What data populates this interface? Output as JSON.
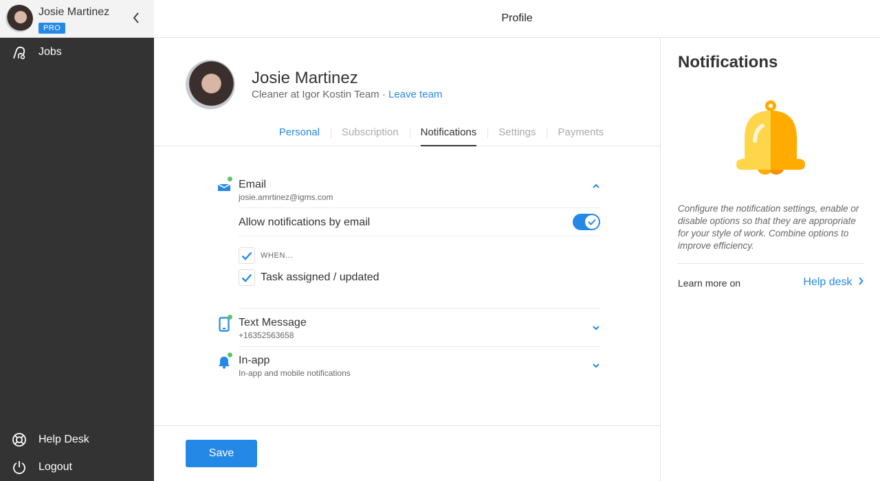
{
  "sidebar": {
    "user_name": "Josie Martinez",
    "badge": "PRO",
    "collapse_icon": "chevron-left",
    "items": [
      {
        "label": "Jobs",
        "icon": "vacuum-icon"
      }
    ],
    "bottom_items": [
      {
        "label": "Help Desk",
        "icon": "lifebuoy-icon"
      },
      {
        "label": "Logout",
        "icon": "power-icon"
      }
    ]
  },
  "header": {
    "title": "Profile"
  },
  "profile": {
    "name": "Josie Martinez",
    "role": "Cleaner at Igor Kostin Team",
    "separator": " · ",
    "leave_link": "Leave team"
  },
  "tabs": [
    {
      "label": "Personal",
      "state": "link"
    },
    {
      "label": "Subscription",
      "state": "inactive"
    },
    {
      "label": "Notifications",
      "state": "active"
    },
    {
      "label": "Settings",
      "state": "inactive"
    },
    {
      "label": "Payments",
      "state": "inactive"
    }
  ],
  "notifications": {
    "email": {
      "title": "Email",
      "subtitle": "josie.amrtinez@igms.com",
      "expanded": true,
      "toggle_label": "Allow notifications by email",
      "toggle_on": true,
      "when_label": "WHEN...",
      "when_checked": true,
      "options": [
        {
          "label": "Task assigned / updated",
          "checked": true
        }
      ]
    },
    "sms": {
      "title": "Text Message",
      "subtitle": "+16352563658",
      "expanded": false
    },
    "inapp": {
      "title": "In-app",
      "subtitle": "In-app and mobile notifications",
      "expanded": false
    }
  },
  "footer": {
    "save_label": "Save"
  },
  "info_panel": {
    "title": "Notifications",
    "description": "Configure the notification settings, enable or disable options so that they are appropriate for your style of work. Combine options to improve efficiency.",
    "learn_more": "Learn more on",
    "help_link": "Help desk"
  },
  "colors": {
    "accent": "#2489e6",
    "sidebar_bg": "#333333",
    "status_dot": "#5cc36a",
    "bell_light": "#ffd54a",
    "bell_dark": "#ffab00"
  }
}
